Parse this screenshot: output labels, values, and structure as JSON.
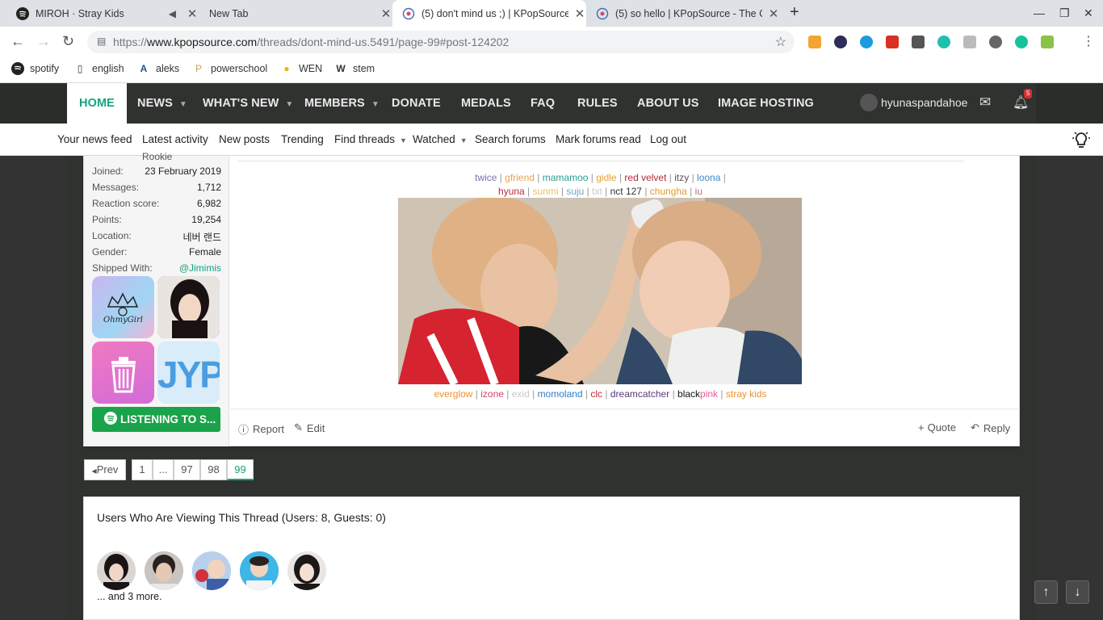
{
  "browser": {
    "tabs": [
      {
        "title": "MIROH · Stray Kids",
        "icon": "spotify-icon"
      },
      {
        "title": "New Tab",
        "icon": ""
      },
      {
        "title": "(5) don't mind us ;) | KPopSource",
        "icon": "kpopsource-icon"
      },
      {
        "title": "(5) so hello | KPopSource - The C",
        "icon": "kpopsource-icon"
      }
    ],
    "url_prefix": "https://",
    "url_domain": "www.kpopsource.com",
    "url_path": "/threads/dont-mind-us.5491/page-99#post-124202",
    "bookmarks": [
      "spotify",
      "english",
      "aleks",
      "powerschool",
      "WEN",
      "stem"
    ]
  },
  "site": {
    "nav": [
      "HOME",
      "NEWS",
      "WHAT'S NEW",
      "MEMBERS",
      "DONATE",
      "MEDALS",
      "FAQ",
      "RULES",
      "ABOUT US",
      "IMAGE HOSTING"
    ],
    "username": "hyunaspandahoe",
    "alert_count": "5",
    "subnav": [
      "Your news feed",
      "Latest activity",
      "New posts",
      "Trending",
      "Find threads",
      "Watched",
      "Search forums",
      "Mark forums read",
      "Log out"
    ]
  },
  "user_info": {
    "rank": "Rookie",
    "rows": [
      {
        "k": "Joined:",
        "v": "23 February 2019"
      },
      {
        "k": "Messages:",
        "v": "1,712"
      },
      {
        "k": "Reaction score:",
        "v": "6,982"
      },
      {
        "k": "Points:",
        "v": "19,254"
      },
      {
        "k": "Location:",
        "v": "네버 랜드"
      },
      {
        "k": "Gender:",
        "v": "Female"
      },
      {
        "k": "Shipped With:",
        "v": "@Jimimis"
      }
    ],
    "medal_ohmygirl_text": "OhmyGirl",
    "medal_jyp_text": "JYP",
    "listening": "LISTENING TO S..."
  },
  "signature": {
    "line1": [
      {
        "t": "twice",
        "c": "#7b6fb0"
      },
      {
        "t": "gfriend",
        "c": "#e8a24a"
      },
      {
        "t": "mamamoo",
        "c": "#2a9d8f"
      },
      {
        "t": "gidle",
        "c": "#e2a33a"
      },
      {
        "t": "red velvet",
        "c": "#b5263a"
      },
      {
        "t": "itzy",
        "c": "#555555"
      },
      {
        "t": "loona",
        "c": "#3b8bc4"
      }
    ],
    "line2": [
      {
        "t": "hyuna",
        "c": "#c0283a"
      },
      {
        "t": "sunmi",
        "c": "#f0c060"
      },
      {
        "t": "suju",
        "c": "#6aa8c8"
      },
      {
        "t": "txt",
        "c": "#c8c8c8"
      },
      {
        "t": "nct 127",
        "c": "#333333"
      },
      {
        "t": "chungha",
        "c": "#e29a2e"
      },
      {
        "t": "iu",
        "c": "#c07080"
      }
    ],
    "line3": [
      {
        "t": "everglow",
        "c": "#e8962e"
      },
      {
        "t": "izone",
        "c": "#d4456a"
      },
      {
        "t": "exid",
        "c": "#c8c8c8"
      },
      {
        "t": "momoland",
        "c": "#2f7fc4"
      },
      {
        "t": "clc",
        "c": "#c62a3a"
      },
      {
        "t": "dreamcatcher",
        "c": "#5b3a7a"
      }
    ],
    "line3_black": "black",
    "line3_pink": "pink",
    "line3_stray": "stray kids",
    "sep": "|"
  },
  "post_actions": {
    "report": "Report",
    "edit": "Edit",
    "quote": "Quote",
    "reply": "Reply"
  },
  "pagination": {
    "prev": "Prev",
    "pages": [
      "1",
      "...",
      "97",
      "98",
      "99"
    ],
    "current": "99"
  },
  "viewers": {
    "title": "Users Who Are Viewing This Thread (Users: 8, Guests: 0)",
    "more": "... and 3 more."
  },
  "colors": {
    "accent": "#13a37f",
    "nav_bg": "#2f322f",
    "spotify_green": "#1aa34a"
  }
}
